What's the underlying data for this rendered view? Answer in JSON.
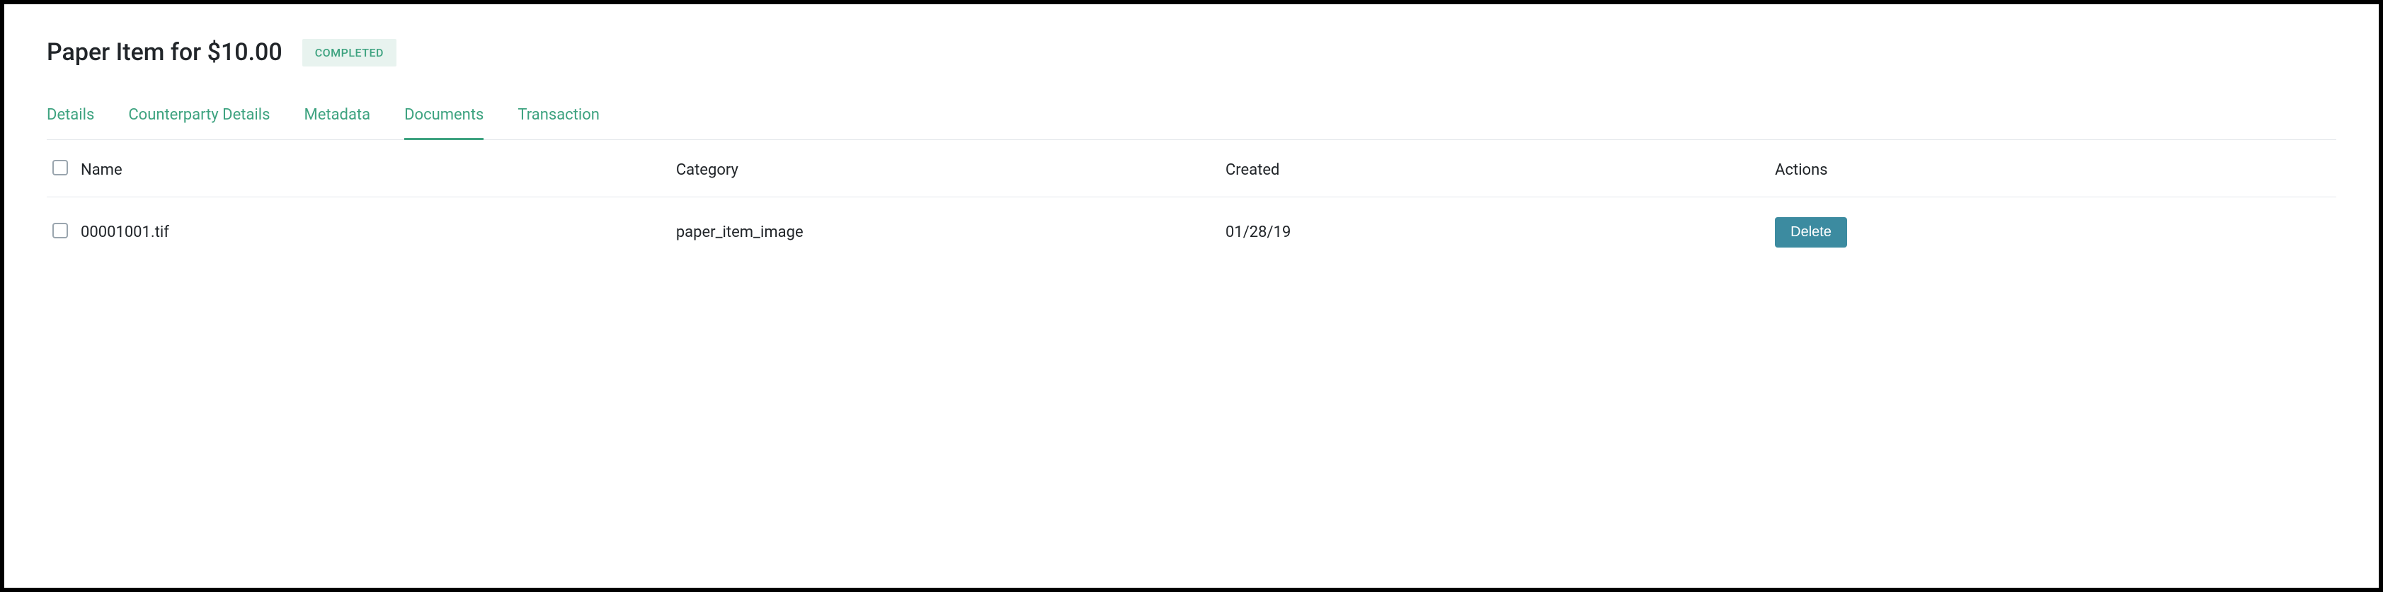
{
  "header": {
    "title": "Paper Item for $10.00",
    "status_badge": "COMPLETED"
  },
  "tabs": [
    {
      "label": "Details",
      "active": false
    },
    {
      "label": "Counterparty Details",
      "active": false
    },
    {
      "label": "Metadata",
      "active": false
    },
    {
      "label": "Documents",
      "active": true
    },
    {
      "label": "Transaction",
      "active": false
    }
  ],
  "table": {
    "headers": {
      "name": "Name",
      "category": "Category",
      "created": "Created",
      "actions": "Actions"
    },
    "rows": [
      {
        "name": "00001001.tif",
        "category": "paper_item_image",
        "created": "01/28/19",
        "action_label": "Delete"
      }
    ]
  }
}
